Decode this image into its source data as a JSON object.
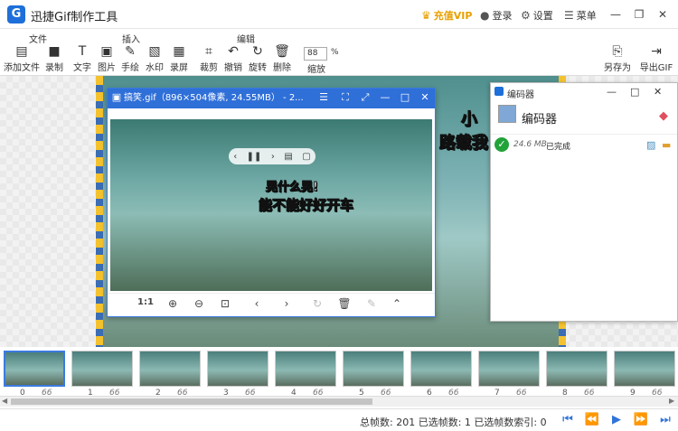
{
  "app": {
    "title": "迅捷Gif制作工具",
    "logo": "G"
  },
  "titlebar": {
    "vip": "充值VIP",
    "login": "登录",
    "settings": "设置",
    "menu": "菜单"
  },
  "toolbar": {
    "groups": {
      "file": "文件",
      "insert": "插入",
      "edit": "编辑"
    },
    "add_file": "添加文件",
    "record": "录制",
    "text": "文字",
    "image": "图片",
    "draw": "手绘",
    "watermark": "水印",
    "screen_record": "录屏",
    "crop": "裁剪",
    "undo": "撤销",
    "rotate": "旋转",
    "delete": "删除",
    "zoom_value": "88",
    "zoom_unit": "%",
    "zoom_label": "缩放",
    "save_as": "另存为",
    "export_gif": "导出GIF"
  },
  "viewer": {
    "title": "搞笑.gif（896×504像素, 24.55MB） - 2...",
    "caption1": "晃什么晃!",
    "caption2": "能不能好好开车",
    "ratio_label": "1:1"
  },
  "main_caption": {
    "line1": "小",
    "line2": "路载我"
  },
  "encoder": {
    "window_title": "编码器",
    "header": "编码器",
    "size": "24.6 MB",
    "status": "已完成"
  },
  "frames": [
    {
      "num": "0",
      "ms": "66 ms"
    },
    {
      "num": "1",
      "ms": "66 ms"
    },
    {
      "num": "2",
      "ms": "66 ms"
    },
    {
      "num": "3",
      "ms": "66 ms"
    },
    {
      "num": "4",
      "ms": "66 ms"
    },
    {
      "num": "5",
      "ms": "66 ms"
    },
    {
      "num": "6",
      "ms": "66 ms"
    },
    {
      "num": "7",
      "ms": "66 ms"
    },
    {
      "num": "8",
      "ms": "66 ms"
    },
    {
      "num": "9",
      "ms": "66 ms"
    }
  ],
  "status": {
    "text": "总帧数: 201   已选帧数: 1   已选帧数索引: 0"
  },
  "colors": {
    "accent": "#2f74d8",
    "vip": "#e8a000",
    "done": "#22a33a"
  }
}
